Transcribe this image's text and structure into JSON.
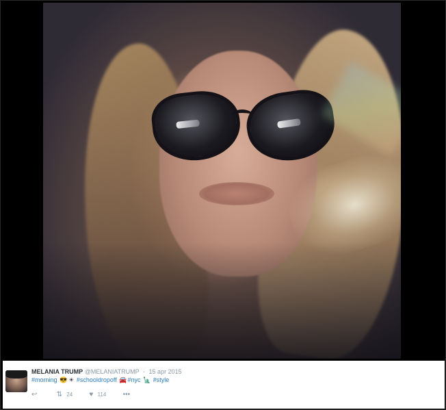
{
  "tweet": {
    "author_name": "MELANIA TRUMP",
    "author_handle": "@MELANIATRUMP",
    "date": "15 apr 2015",
    "text_parts": {
      "tag_morning": "#morning",
      "emoji_1": "😎",
      "emoji_2": "☀",
      "tag_schooldropoff": "#schooldropoff",
      "emoji_3": "🚘",
      "tag_nyc": "#nyc",
      "emoji_4": "🗽",
      "tag_style": "#style"
    },
    "actions": {
      "reply_icon": "reply-icon",
      "retweet_count": "24",
      "like_count": "114",
      "more_icon": "more-icon"
    }
  },
  "colors": {
    "name": "#292f33",
    "muted": "#8899a6",
    "link": "#2b7bb9",
    "background": "#000000",
    "card": "#ffffff"
  }
}
